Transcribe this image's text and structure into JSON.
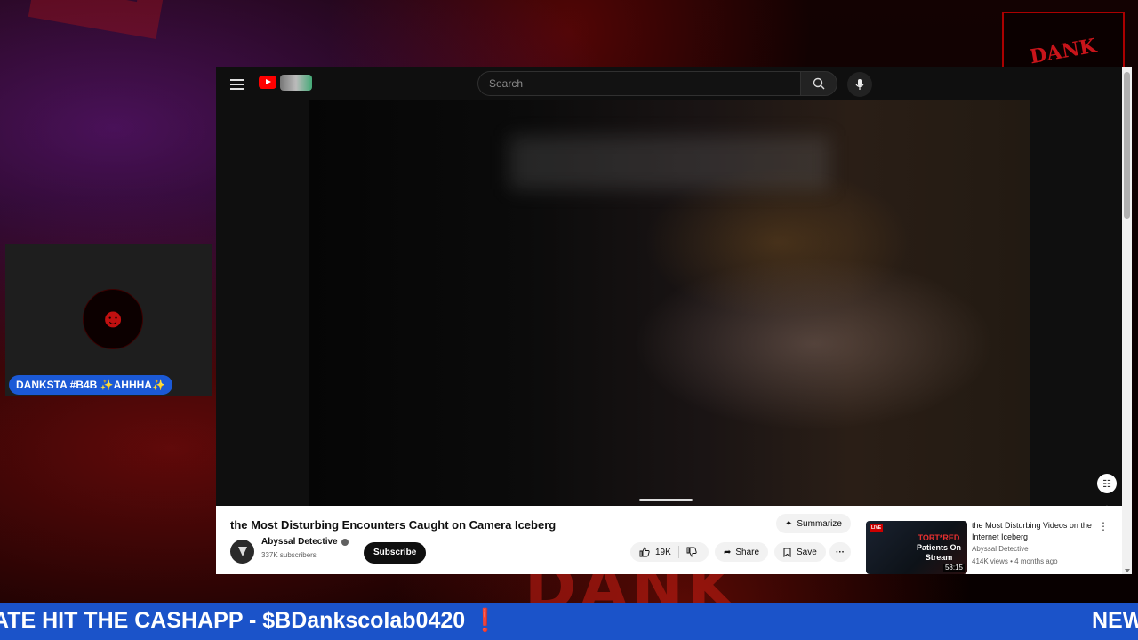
{
  "overlay": {
    "cam_label": "DANKSTA #B4B ✨AHHHA✨",
    "ticker_text": "ATE HIT THE CASHAPP - $BDankscolab0420",
    "ticker_mark": "❗",
    "ticker_next": "NEW",
    "corner_logo_text": "DANK"
  },
  "youtube": {
    "search_placeholder": "Search",
    "video_title": "the Most Disturbing Encounters Caught on Camera Iceberg",
    "summarize_label": "Summarize",
    "channel_name": "Abyssal Detective",
    "channel_subs": "337K subscribers",
    "subscribe_label": "Subscribe",
    "likes": "19K",
    "share_label": "Share",
    "save_label": "Save",
    "more_label": "···",
    "recommendation": {
      "title": "the Most Disturbing Videos on the Internet Iceberg",
      "channel": "Abyssal Detective",
      "meta": "414K views • 4 months ago",
      "duration": "58:15",
      "live_badge": "LIVE",
      "thumb_text_red": "TORT*RED",
      "thumb_text_white": "Patients On Stream"
    }
  },
  "colors": {
    "ticker_bg": "#1b53c9",
    "youtube_red": "#ff0000",
    "name_badge_bg": "#1b59d6"
  }
}
